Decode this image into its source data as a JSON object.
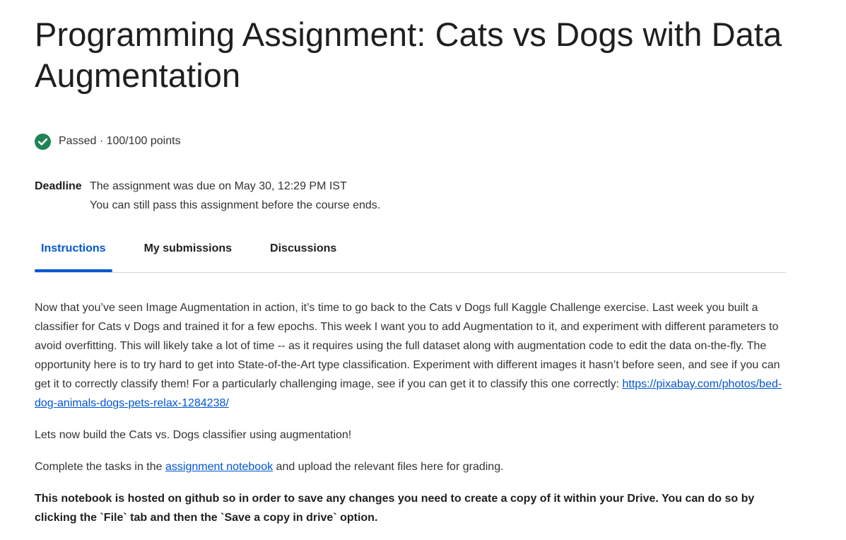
{
  "page": {
    "title": "Programming Assignment: Cats vs Dogs with Data Augmentation"
  },
  "status": {
    "icon": "check-circle-icon",
    "text": "Passed · 100/100 points",
    "color": "#1f8354"
  },
  "deadline": {
    "label": "Deadline",
    "line1": "The assignment was due on May 30, 12:29 PM IST",
    "line2": "You can still pass this assignment before the course ends."
  },
  "tabs": [
    {
      "label": "Instructions",
      "active": true
    },
    {
      "label": "My submissions",
      "active": false
    },
    {
      "label": "Discussions",
      "active": false
    }
  ],
  "accent_color": "#0056d2",
  "instructions": {
    "para1_text": "Now that you’ve seen Image Augmentation in action, it’s time to go back to the Cats v Dogs full Kaggle Challenge exercise. Last week you built a classifier for Cats v Dogs and trained it for a few epochs. This week I want you to add Augmentation to it, and experiment with different parameters to avoid overfitting. This will likely take a lot of time -- as it requires using the full dataset along with augmentation code to edit the data on-the-fly. The opportunity here is to try hard to get into State-of-the-Art type classification. Experiment with different images it hasn’t before seen, and see if you can get it to correctly classify them! For a particularly challenging image, see if you can get it to classify this one correctly: ",
    "para1_link": "https://pixabay.com/photos/bed-dog-animals-dogs-pets-relax-1284238/",
    "para2": "Lets now build the Cats vs. Dogs classifier using augmentation!",
    "para3_before": "Complete the tasks in the ",
    "para3_link": "assignment notebook",
    "para3_after": " and upload the relevant files here for grading.",
    "para4": "This notebook is hosted on github so in order to save any changes you need to create a copy of it within your Drive. You can do so by clicking the `File` tab and then the `Save a copy in drive` option."
  }
}
